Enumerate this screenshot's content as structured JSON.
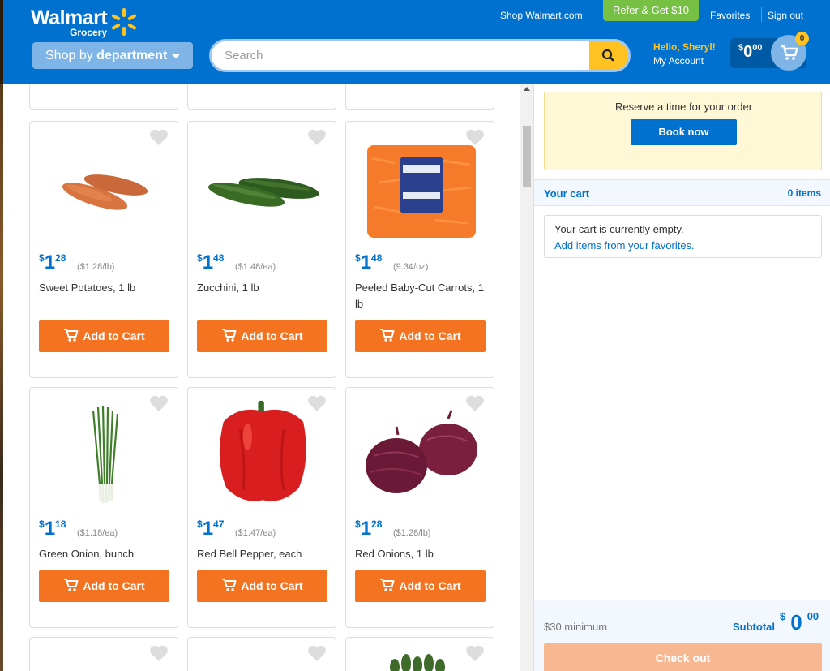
{
  "header": {
    "logo_word": "Walmart",
    "logo_sub": "Grocery",
    "shop_walmart": "Shop Walmart.com",
    "refer": "Refer & Get $10",
    "favorites": "Favorites",
    "sign_out": "Sign out",
    "shop_by_prefix": "Shop by",
    "shop_by_bold": "department",
    "search_placeholder": "Search",
    "hello": "Hello, Sheryl!",
    "my_account": "My Account",
    "cart_dollar": "$",
    "cart_whole": "0",
    "cart_cents": "00",
    "cart_count": "0"
  },
  "products": [
    {
      "name": "Sweet Potatoes, 1 lb",
      "whole": "1",
      "cents": "28",
      "unit": "($1.28/lb)",
      "image": "sweet-potato"
    },
    {
      "name": "Zucchini, 1 lb",
      "whole": "1",
      "cents": "48",
      "unit": "($1.48/ea)",
      "image": "zucchini"
    },
    {
      "name": "Peeled Baby-Cut Carrots, 1 lb",
      "whole": "1",
      "cents": "48",
      "unit": "(9.3¢/oz)",
      "image": "carrots"
    },
    {
      "name": "Green Onion, bunch",
      "whole": "1",
      "cents": "18",
      "unit": "($1.18/ea)",
      "image": "green-onion"
    },
    {
      "name": "Red Bell Pepper, each",
      "whole": "1",
      "cents": "47",
      "unit": "($1.47/ea)",
      "image": "red-pepper"
    },
    {
      "name": "Red Onions, 1 lb",
      "whole": "1",
      "cents": "28",
      "unit": "($1.28/lb)",
      "image": "red-onion"
    }
  ],
  "product_common": {
    "dollar": "$",
    "add_to_cart": "Add to Cart"
  },
  "sidebar": {
    "reserve_text": "Reserve a time for your order",
    "book_now": "Book now",
    "your_cart": "Your cart",
    "item_count": "0 items",
    "empty_text": "Your cart is currently empty.",
    "empty_link": "Add items from your favorites.",
    "minimum": "$30 minimum",
    "subtotal_label": "Subtotal",
    "subtotal_dollar": "$",
    "subtotal_whole": "0",
    "subtotal_cents": "00",
    "checkout": "Check out"
  },
  "colors": {
    "brand_blue": "#0071ce",
    "spark_yellow": "#ffc220",
    "add_orange": "#f47321",
    "refer_green": "#76c043"
  }
}
